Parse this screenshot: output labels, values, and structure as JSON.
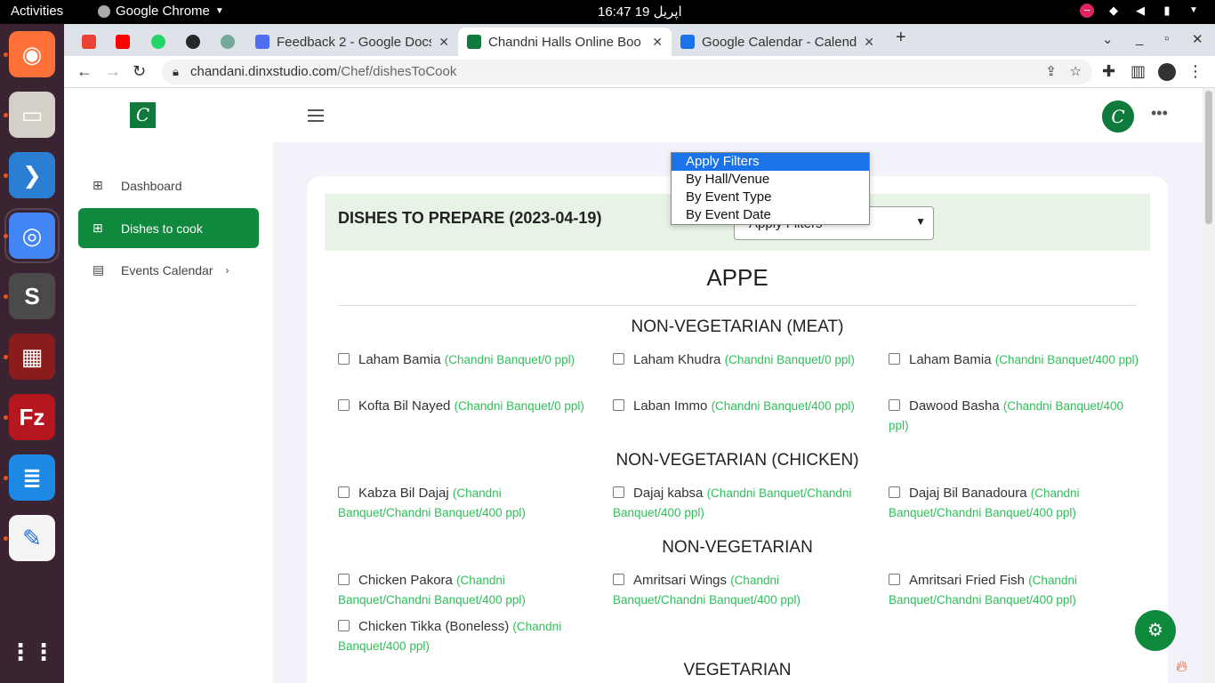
{
  "topbar": {
    "activities": "Activities",
    "app": "Google Chrome",
    "clock": "16:47  اپریل 19"
  },
  "dock": [
    {
      "name": "firefox-icon",
      "color": "#ff7139",
      "glyph": "◉"
    },
    {
      "name": "files-icon",
      "color": "#d4d0c8",
      "glyph": "▭"
    },
    {
      "name": "vscode-icon",
      "color": "#2a7fd4",
      "glyph": "❯"
    },
    {
      "name": "chrome-icon",
      "color": "#4285f4",
      "glyph": "◎"
    },
    {
      "name": "sublime-icon",
      "color": "#4a4a4a",
      "glyph": "S"
    },
    {
      "name": "terminal-icon",
      "color": "#8b1c1c",
      "glyph": "▦"
    },
    {
      "name": "filezilla-icon",
      "color": "#b5171e",
      "glyph": "Fz"
    },
    {
      "name": "writer-icon",
      "color": "#1e88e5",
      "glyph": "≣"
    },
    {
      "name": "text-editor-icon",
      "color": "#f5f5f5",
      "glyph": "✎"
    },
    {
      "name": "app-grid-icon",
      "color": "#3b2432",
      "glyph": "⋮⋮"
    }
  ],
  "tabs": [
    {
      "title": "Feedback 2 - Google Docs",
      "color": "#4e6ef2"
    },
    {
      "title": "Chandni Halls Online Boo",
      "color": "#0f7a3c"
    },
    {
      "title": "Google Calendar - Calend",
      "color": "#1a73e8"
    }
  ],
  "url": {
    "host": "chandani.dinxstudio.com",
    "path": "/Chef/dishesToCook"
  },
  "sidebar": {
    "items": [
      {
        "label": "Dashboard"
      },
      {
        "label": "Dishes to cook"
      },
      {
        "label": "Events Calendar"
      }
    ]
  },
  "page": {
    "title": "DISHES TO PREPARE (2023-04-19)",
    "filter_value": "Apply Filters",
    "filter_options": [
      "Apply Filters",
      "By Hall/Venue",
      "By Event Type",
      "By Event Date"
    ],
    "category_heading": "APPE",
    "sections": [
      {
        "heading": "NON-VEGETARIAN (MEAT)",
        "dishes": [
          {
            "name": "Laham Bamia",
            "meta": "(Chandni Banquet/0 ppl)"
          },
          {
            "name": "Laham Khudra",
            "meta": "(Chandni Banquet/0 ppl)"
          },
          {
            "name": "Laham Bamia",
            "meta": "(Chandni Banquet/400 ppl)"
          },
          {
            "name": "Kofta Bil Nayed",
            "meta": "(Chandni Banquet/0 ppl)"
          },
          {
            "name": "Laban Immo",
            "meta": "(Chandni Banquet/400 ppl)"
          },
          {
            "name": "Dawood Basha",
            "meta": "(Chandni Banquet/400 ppl)"
          }
        ]
      },
      {
        "heading": "NON-VEGETARIAN (CHICKEN)",
        "dishes": [
          {
            "name": "Kabza Bil Dajaj",
            "meta": "(Chandni Banquet/Chandni Banquet/400 ppl)"
          },
          {
            "name": "Dajaj kabsa",
            "meta": "(Chandni Banquet/Chandni Banquet/400 ppl)"
          },
          {
            "name": "Dajaj Bil Banadoura",
            "meta": "(Chandni Banquet/Chandni Banquet/400 ppl)"
          }
        ]
      },
      {
        "heading": "NON-VEGETARIAN",
        "dishes": [
          {
            "name": "Chicken Pakora",
            "meta": "(Chandni Banquet/Chandni Banquet/400 ppl)"
          },
          {
            "name": "Amritsari Wings",
            "meta": "(Chandni Banquet/Chandni Banquet/400 ppl)"
          },
          {
            "name": "Amritsari Fried Fish",
            "meta": "(Chandni Banquet/Chandni Banquet/400 ppl)"
          },
          {
            "name": "Chicken Tikka (Boneless)",
            "meta": "(Chandni Banquet/400 ppl)"
          }
        ]
      },
      {
        "heading": "VEGETARIAN",
        "dishes": []
      }
    ]
  },
  "colors": {
    "brand": "#0f8a3c",
    "meta_green": "#2fbf5a",
    "banner_bg": "#e7f3e4"
  }
}
